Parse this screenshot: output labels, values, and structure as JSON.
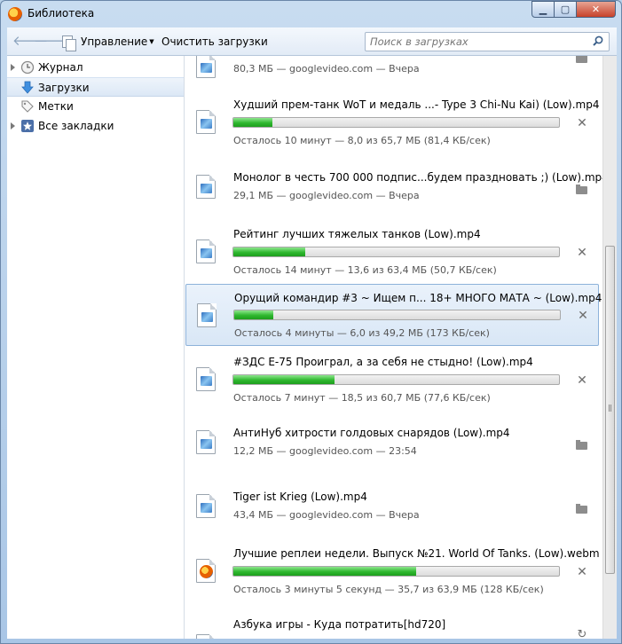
{
  "window": {
    "title": "Библиотека",
    "buttons": {
      "minimize": "▁",
      "maximize": "▢",
      "close": "✕"
    }
  },
  "toolbar": {
    "organize_label": "Управление",
    "clear_label": "Очистить загрузки",
    "search_placeholder": "Поиск в загрузках"
  },
  "sidebar": {
    "items": [
      {
        "label": "Журнал",
        "icon": "clock-icon",
        "expandable": true
      },
      {
        "label": "Загрузки",
        "icon": "download-arrow-icon",
        "selected": true
      },
      {
        "label": "Метки",
        "icon": "tag-icon"
      },
      {
        "label": "Все закладки",
        "icon": "bookmarks-star-icon",
        "expandable": true
      }
    ]
  },
  "downloads": [
    {
      "name": "",
      "status": "80,3 МБ — googlevideo.com — Вчера",
      "state": "done",
      "icon": "video-file-icon"
    },
    {
      "name": "Худший прем-танк WoT и медаль ...- Type 3 Chi-Nu Kai) (Low).mp4",
      "status": "Осталось 10 минут — 8,0 из 65,7 МБ (81,4 КБ/сек)",
      "state": "active",
      "progress": 0.12,
      "icon": "video-file-icon"
    },
    {
      "name": "Монолог в честь 700 000 подпис...будем праздновать ;) (Low).mp4",
      "status": "29,1 МБ — googlevideo.com — Вчера",
      "state": "done",
      "icon": "video-file-icon"
    },
    {
      "name": "Рейтинг лучших тяжелых танков (Low).mp4",
      "status": "Осталось 14 минут — 13,6 из 63,4 МБ (50,7 КБ/сек)",
      "state": "active",
      "progress": 0.22,
      "icon": "video-file-icon"
    },
    {
      "name": "Орущий командир #3 ~ Ищем п... 18+ МНОГО МАТА ~ (Low).mp4",
      "status": "Осталось 4 минуты — 6,0 из 49,2 МБ (173 КБ/сек)",
      "state": "active",
      "progress": 0.12,
      "selected": true,
      "icon": "video-file-icon"
    },
    {
      "name": "#ЗДС Е-75 Проиграл, а за себя не стыдно! (Low).mp4",
      "status": "Осталось 7 минут — 18,5 из 60,7 МБ (77,6 КБ/сек)",
      "state": "active",
      "progress": 0.31,
      "icon": "video-file-icon"
    },
    {
      "name": "АнтиНуб хитрости голдовых снарядов (Low).mp4",
      "status": "12,2 МБ — googlevideo.com — 23:54",
      "state": "done",
      "icon": "video-file-icon"
    },
    {
      "name": "Tiger ist Krieg (Low).mp4",
      "status": "43,4 МБ — googlevideo.com — Вчера",
      "state": "done",
      "icon": "video-file-icon"
    },
    {
      "name": "Лучшие реплеи недели. Выпуск №21. World Of Tanks. (Low).webm",
      "status": "Осталось 3 минуты 5 секунд — 35,7 из 63,9 МБ (128 КБ/сек)",
      "state": "active",
      "progress": 0.56,
      "icon": "firefox-file-icon"
    },
    {
      "name": "Азбука игры - Куда потратить[hd720]",
      "status": "",
      "state": "failed",
      "icon": "video-file-icon"
    }
  ],
  "actions": {
    "cancel": "✕",
    "retry": "↻"
  },
  "colors": {
    "progress_fill": "#2fb82f",
    "selection": "#d9e7f6",
    "window_frame": "#a9c6e6"
  }
}
